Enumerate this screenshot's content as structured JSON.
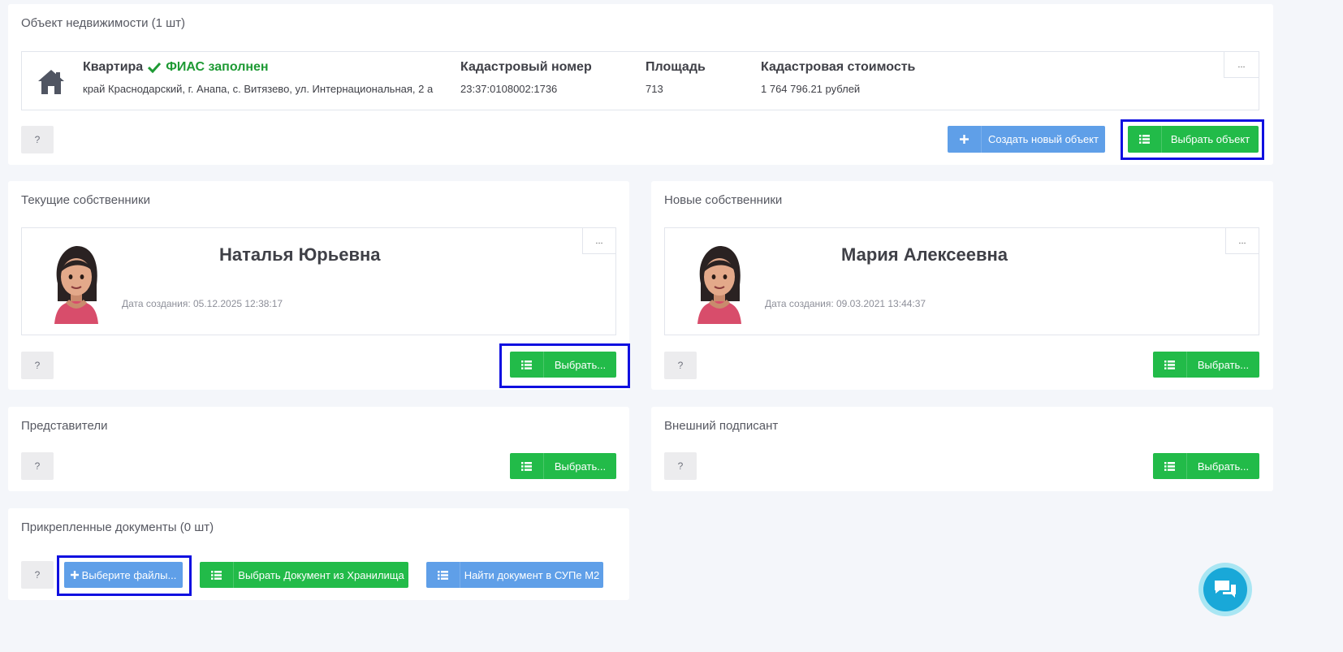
{
  "property_panel": {
    "title": "Объект недвижимости (1 шт)",
    "type": "Квартира",
    "fias_status": "ФИАС заполнен",
    "address": "край Краснодарский, г. Анапа, с. Витязево, ул. Интернациональная, 2 а",
    "cadastral_number_label": "Кадастровый номер",
    "cadastral_number": "23:37:0108002:1736",
    "area_label": "Площадь",
    "area": "713",
    "cadastral_value_label": "Кадастровая стоимость",
    "cadastral_value": "1 764 796.21 рублей",
    "more": "...",
    "help": "?",
    "create_button": "Создать новый объект",
    "select_button": "Выбрать объект"
  },
  "current_owners": {
    "title": "Текущие собственники",
    "name": "Наталья Юрьевна",
    "date": "Дата создания: 05.12.2025 12:38:17",
    "more": "...",
    "help": "?",
    "select_button": "Выбрать..."
  },
  "new_owners": {
    "title": "Новые собственники",
    "name": "Мария Алексеевна",
    "date": "Дата создания: 09.03.2021 13:44:37",
    "more": "...",
    "help": "?",
    "select_button": "Выбрать..."
  },
  "representatives": {
    "title": "Представители",
    "help": "?",
    "select_button": "Выбрать..."
  },
  "external_signer": {
    "title": "Внешний подписант",
    "help": "?",
    "select_button": "Выбрать..."
  },
  "documents": {
    "title": "Прикрепленные документы (0 шт)",
    "help": "?",
    "choose_files_button": "Выберите файлы...",
    "storage_button": "Выбрать Документ из Хранилища",
    "supe_button": "Найти документ в СУПе М2"
  },
  "colors": {
    "green": "#22bb49",
    "blue": "#5f9fe8",
    "highlight": "#1010e0",
    "fias_green": "#1e9a34"
  }
}
